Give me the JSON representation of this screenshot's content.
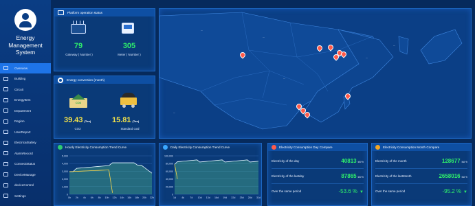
{
  "sidebar": {
    "title": "Energy\nManagement\nSystem",
    "items": [
      {
        "label": "Overview",
        "icon": "monitor-icon"
      },
      {
        "label": "Building",
        "icon": "building-icon"
      },
      {
        "label": "Circuit",
        "icon": "circuit-icon"
      },
      {
        "label": "EnergyItem",
        "icon": "energy-item-icon"
      },
      {
        "label": "Department",
        "icon": "department-icon"
      },
      {
        "label": "Region",
        "icon": "region-icon"
      },
      {
        "label": "UserReport",
        "icon": "report-icon"
      },
      {
        "label": "ElectricalSafety",
        "icon": "safety-icon"
      },
      {
        "label": "AlarmRecord",
        "icon": "alarm-icon"
      },
      {
        "label": "ConnectStatus",
        "icon": "connect-icon"
      },
      {
        "label": "DeviceManage",
        "icon": "device-manage-icon"
      },
      {
        "label": "deviceControl",
        "icon": "device-control-icon"
      },
      {
        "label": "Settings",
        "icon": "settings-icon"
      }
    ]
  },
  "platform": {
    "title": "Platform operation status",
    "gateway_value": "79",
    "gateway_label": "Gateway ( Number )",
    "meter_value": "305",
    "meter_label": "Meter ( Number )"
  },
  "conversion": {
    "title": "Energy conversion (month)",
    "co2_value": "39.43",
    "co2_unit": "(Ton)",
    "co2_label": "CO2",
    "coal_value": "15.81",
    "coal_unit": "(Ton)",
    "coal_label": "Standard coal",
    "co2_badge": "CO2"
  },
  "hourly": {
    "title": "Hourly Electricity Consumption Trend Curve",
    "yticks": [
      "5,000",
      "4,000",
      "3,000",
      "2,000",
      "1,000",
      "0"
    ],
    "xticks": [
      "0h",
      "2h",
      "4h",
      "6h",
      "8h",
      "10h",
      "12h",
      "14h",
      "16h",
      "18h",
      "20h",
      "22h"
    ]
  },
  "daily": {
    "title": "Daily Electricity Consumption Trend Curve",
    "yticks": [
      "100,000",
      "80,000",
      "60,000",
      "40,000",
      "20,000",
      "0"
    ],
    "xticks": [
      "1d",
      "4d",
      "7d",
      "10d",
      "13d",
      "16d",
      "19d",
      "22d",
      "25d",
      "28d",
      "31d"
    ]
  },
  "day_compare": {
    "title": "Electricity Consumption Day Compare",
    "rows": [
      {
        "label": "Electricity of the day",
        "value": "40813",
        "unit": "kW·h"
      },
      {
        "label": "Electricity of the lastday",
        "value": "87865",
        "unit": "kW·h"
      },
      {
        "label": "Over the same period",
        "value": "-53.6 %"
      }
    ]
  },
  "month_compare": {
    "title": "Electricity Consumption Month Compare",
    "rows": [
      {
        "label": "Electricity of the month",
        "value": "128677",
        "unit": "kW·h"
      },
      {
        "label": "Electricity of the lastMonth",
        "value": "2658016",
        "unit": "kW·h"
      },
      {
        "label": "Over the same period",
        "value": "-95.2 %"
      }
    ]
  },
  "colors": {
    "accent": "#1e74e8",
    "panel": "#0a3a78",
    "green": "#2ff06b",
    "yellow": "#ffd84a",
    "pin": "#ff5a4a"
  }
}
